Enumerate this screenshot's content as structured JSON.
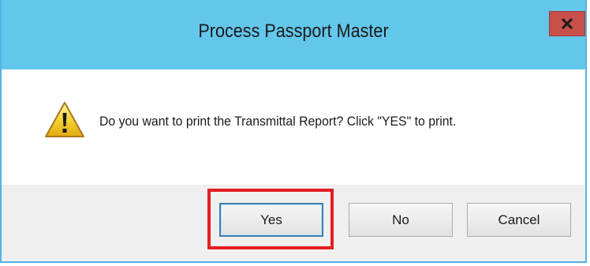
{
  "window": {
    "title": "Process Passport Master",
    "close_label": "x"
  },
  "message": {
    "icon": "warning-icon",
    "text": "Do you want to print the Transmittal Report? Click \"YES\" to print."
  },
  "buttons": {
    "yes_label": "Yes",
    "no_label": "No",
    "cancel_label": "Cancel"
  },
  "colors": {
    "titlebar": "#63c7ec",
    "close_button": "#c7504a",
    "footer": "#efefef",
    "highlight": "#e31e24"
  }
}
